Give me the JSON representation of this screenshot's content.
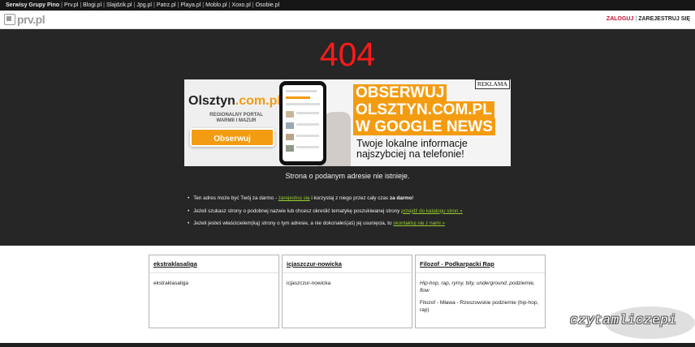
{
  "topbar": {
    "brand": "Serwisy Grupy Pino",
    "links": [
      "Prv.pl",
      "Blogi.pl",
      "Slajdzik.pl",
      "Jpg.pl",
      "Patrz.pl",
      "Playa.pl",
      "Moblo.pl",
      "Xoxo.pl",
      "Osobie.pl"
    ]
  },
  "header": {
    "logo_text": "prv.pl",
    "login": "ZALOGUJ",
    "separator": "|",
    "register": "ZAREJESTRUJ SIĘ"
  },
  "main": {
    "error_code": "404",
    "banner": {
      "reklama": "REKLAMA",
      "logo_main": "Olsztyn",
      "logo_dot": ".com.pl",
      "subtitle_1": "REGIONALNY PORTAL",
      "subtitle_2": "WARMII I MAZUR",
      "button": "Obserwuj",
      "headline_1": "OBSERWUJ",
      "headline_2": "OLSZTYN.COM.PL",
      "headline_3": "W GOOGLE NEWS",
      "tagline_1": "Twoje lokalne informacje",
      "tagline_2": "najszybciej na telefonie!"
    },
    "not_found": "Strona o podanym adresie nie istnieje.",
    "bullets": {
      "b1_pre": "Ten adres może być Twój za darmo - ",
      "b1_link": "zarejestruj się",
      "b1_mid": " i korzystaj z niego przez cały czas ",
      "b1_bold": "za darmo",
      "b1_end": "!",
      "b2_pre": "Jeżeli szukasz strony o podobnej nazwie lub chcesz określić tematykę poszukiwanej strony ",
      "b2_link": "przejdź do katalogu stron »",
      "b3_pre": "Jeżeli jesteś właścicielem(ką) strony o tym adresie, a nie dokonałeś(aś) jej usunięcia, to ",
      "b3_link": "skontaktuj się z nami »"
    }
  },
  "cards": [
    {
      "title": "ekstraklasaliga",
      "desc": "",
      "text": "ekstraklasaliga"
    },
    {
      "title": "icjaszczur-nowicka",
      "desc": "",
      "text": "icjaszczur-nowicka"
    },
    {
      "title": "Filozof - Podkarpacki Rap",
      "desc": "Hip-hop, rap, rymy, bity, underground, podziemie, flow",
      "text": "Filozof - Mława - Rzeszowskie podziemie (hip-hop, rap)"
    }
  ],
  "watermark": "czytamliczepi",
  "colors": {
    "error_red": "#ff1a1a",
    "accent_orange": "#f39c12",
    "link_green": "#9acd32",
    "login_red": "#c8102e"
  }
}
